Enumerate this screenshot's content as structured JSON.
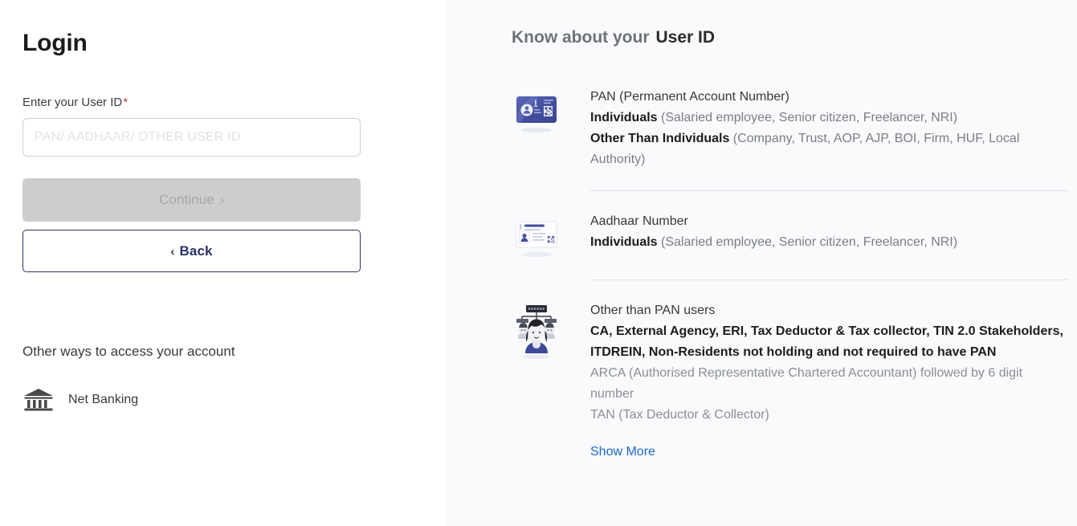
{
  "login": {
    "title": "Login",
    "field_label": "Enter your User ID",
    "required_marker": "*",
    "input_value": "",
    "input_placeholder": "PAN/ AADHAAR/ OTHER USER ID",
    "continue_label": "Continue",
    "continue_chevron": "›",
    "back_label": "Back",
    "back_chevron": "‹",
    "other_ways_title": "Other ways to access your account",
    "net_banking_label": "Net Banking",
    "net_banking_icon": "bank-building-icon"
  },
  "info_panel": {
    "header_light": "Know about your",
    "header_strong": "User ID",
    "show_more_label": "Show More",
    "items": [
      {
        "icon": "pan-card-icon",
        "title": "PAN (Permanent Account Number)",
        "lines": [
          {
            "bold": "Individuals",
            "rest": " (Salaried employee, Senior citizen, Freelancer, NRI)"
          },
          {
            "bold": "Other Than Individuals",
            "rest": " (Company, Trust, AOP, AJP, BOI, Firm, HUF, Local Authority)"
          }
        ]
      },
      {
        "icon": "aadhaar-card-icon",
        "title": "Aadhaar Number",
        "lines": [
          {
            "bold": "Individuals",
            "rest": " (Salaried employee, Senior citizen, Freelancer, NRI)"
          }
        ]
      },
      {
        "icon": "other-users-icon",
        "title": "Other than PAN users",
        "bold_block": "CA, External Agency, ERI, Tax Deductor & Tax collector, TIN 2.0 Stakeholders, ITDREIN, Non-Residents not holding and not required to have PAN",
        "muted_lines": [
          "ARCA (Authorised Representative Chartered Accountant) followed by 6 digit number",
          "TAN (Tax Deductor & Collector)"
        ]
      }
    ]
  },
  "colors": {
    "accent_navy": "#2b3269",
    "link_blue": "#1b6ac4",
    "required_red": "#c0392b",
    "panel_bg": "#f9fafc",
    "disabled_btn": "#cdcdcd"
  }
}
